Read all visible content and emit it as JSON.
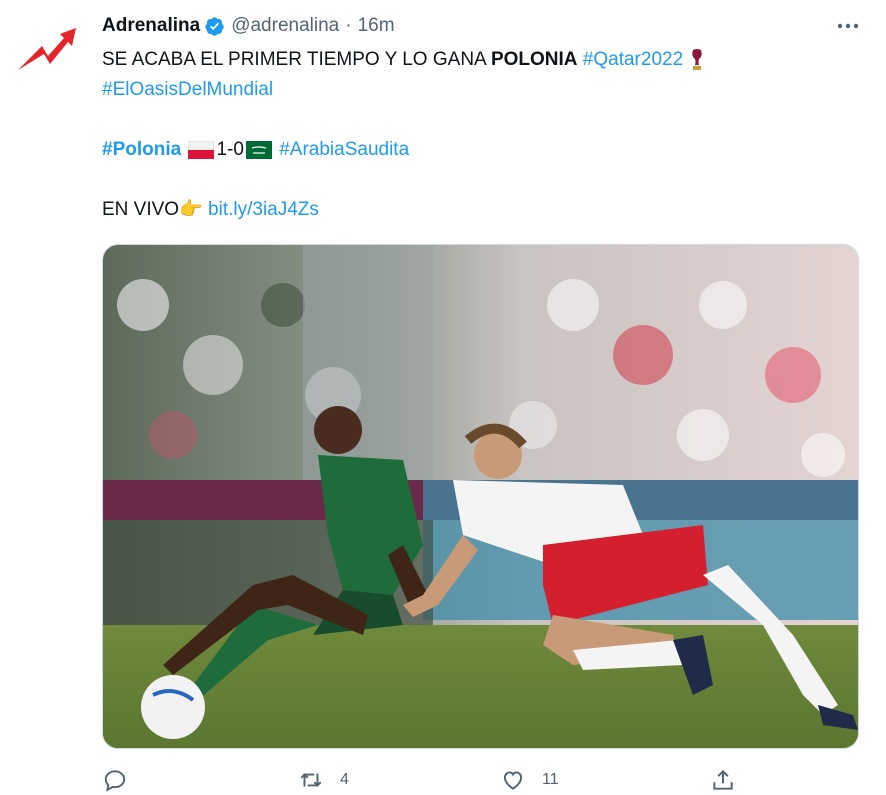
{
  "tweet": {
    "author_name": "Adrenalina",
    "handle": "@adrenalina",
    "separator": "·",
    "time": "16m",
    "verified": true,
    "lines": {
      "l1_text": "SE ACABA EL PRIMER TIEMPO Y LO GANA ",
      "l1_bold": "POLONIA",
      "l1_tag": "#Qatar2022",
      "l2_tag": "#ElOasisDelMundial",
      "l3_tag1": "#Polonia",
      "l3_score": "1-0",
      "l3_tag2": "#ArabiaSaudita",
      "l4_text": "EN VIVO",
      "l4_emoji": "👉",
      "l4_link": "bit.ly/3iaJ4Zs"
    },
    "media_description": "Saudi player in green kit falling after challenge with Poland player in white and red kit"
  },
  "actions": {
    "reply_count": "",
    "retweet_count": "4",
    "like_count": "11"
  },
  "colors": {
    "link": "#1d9bf0",
    "secondary": "#536471",
    "brand_red": "#e4262c"
  },
  "icons": [
    "adrenalina-logo-icon",
    "verified-badge-icon",
    "more-icon",
    "world-cup-trophy-icon",
    "poland-flag-icon",
    "saudi-flag-icon",
    "reply-icon",
    "retweet-icon",
    "like-icon",
    "share-icon"
  ]
}
